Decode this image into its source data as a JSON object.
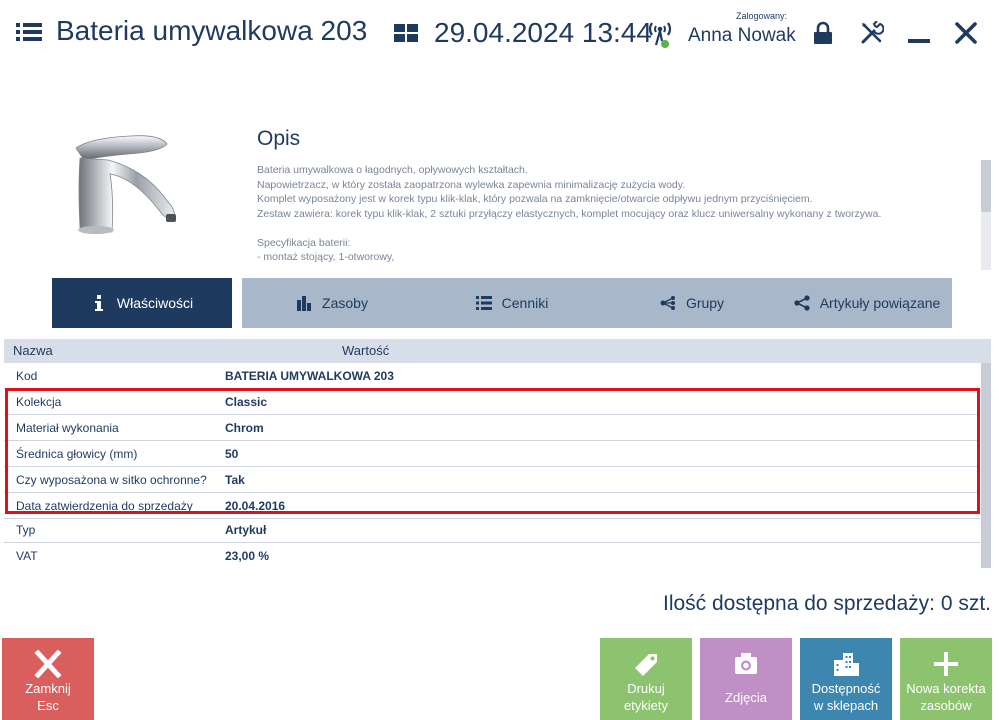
{
  "header": {
    "title": "Bateria umywalkowa 203",
    "datetime": "29.04.2024 13:44",
    "logged_label": "Zalogowany:",
    "user": "Anna Nowak"
  },
  "description": {
    "title": "Opis",
    "lines": [
      "Bateria umywalkowa o łagodnych, opływowych kształtach.",
      "Napowietrzacz, w który została zaopatrzona wylewka zapewnia minimalizację zużycia wody.",
      "Komplet wyposażony jest w korek typu klik-klak, który pozwala na zamknięcie/otwarcie odpływu jednym przyciśnięciem.",
      "Zestaw zawiera: korek typu klik-klak, 2 sztuki przyłączy elastycznych, komplet mocujący oraz klucz uniwersalny wykonany z tworzywa.",
      "Specyfikacja baterii:",
      "- montaż stojący, 1-otworowy,"
    ]
  },
  "tabs": [
    {
      "label": "Właściwości",
      "icon": "info-icon",
      "active": true
    },
    {
      "label": "Zasoby",
      "icon": "warehouse-icon",
      "active": false
    },
    {
      "label": "Cenniki",
      "icon": "list-icon",
      "active": false
    },
    {
      "label": "Grupy",
      "icon": "groups-icon",
      "active": false
    },
    {
      "label": "Artykuły powiązane",
      "icon": "share-icon",
      "active": false
    }
  ],
  "table": {
    "col_name": "Nazwa",
    "col_value": "Wartość",
    "rows": [
      {
        "name": "Kod",
        "value": "BATERIA UMYWALKOWA 203"
      },
      {
        "name": "Kolekcja",
        "value": "Classic"
      },
      {
        "name": "Materiał wykonania",
        "value": "Chrom"
      },
      {
        "name": "Średnica głowicy (mm)",
        "value": "50"
      },
      {
        "name": "Czy wyposażona w sitko ochronne?",
        "value": "Tak"
      },
      {
        "name": "Data zatwierdzenia do sprzedaży",
        "value": "20.04.2016"
      },
      {
        "name": "Typ",
        "value": "Artykuł"
      },
      {
        "name": "VAT",
        "value": "23,00 %"
      }
    ]
  },
  "quantity": "Ilość dostępna do sprzedaży:  0 szt.",
  "buttons": {
    "close": {
      "line1": "Zamknij",
      "line2": "Esc"
    },
    "print": {
      "line1": "Drukuj",
      "line2": "etykiety"
    },
    "photos": {
      "line1": "Zdjęcia"
    },
    "avail": {
      "line1": "Dostępność",
      "line2": "w sklepach"
    },
    "new": {
      "line1": "Nowa korekta",
      "line2": "zasobów"
    }
  },
  "colors": {
    "primary": "#1f3a5f",
    "tab_inactive": "#a8b7c9",
    "highlight": "#e0101a",
    "close_button": "#d95f5f",
    "green_button": "#8dc26e",
    "photo_button": "#c08fc6",
    "blue_button": "#3d86b0"
  }
}
